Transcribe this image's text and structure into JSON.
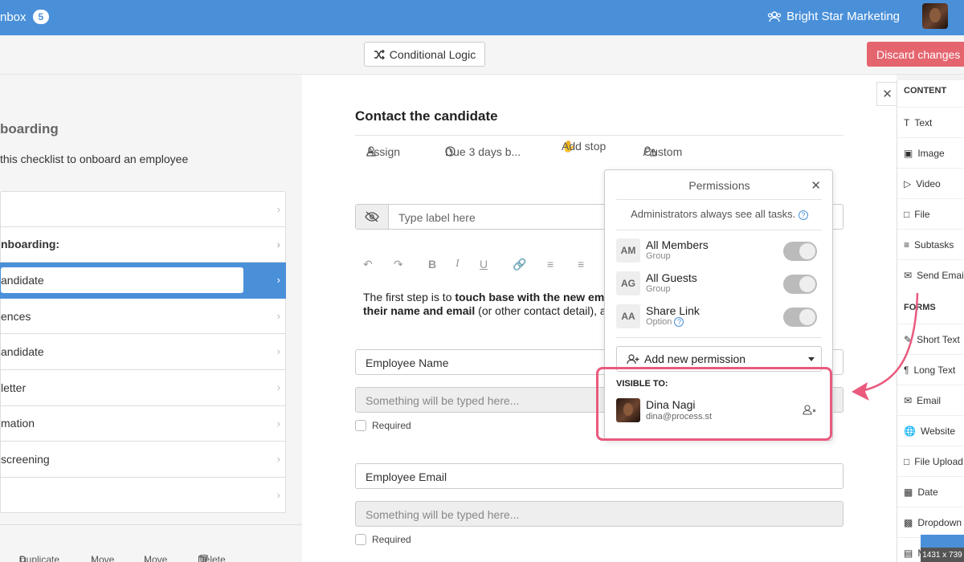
{
  "topbar": {
    "inbox_label": "nbox",
    "inbox_count": "5",
    "company": "Bright Star Marketing"
  },
  "toolbar": {
    "conditional_logic": "Conditional Logic",
    "discard": "Discard changes"
  },
  "left": {
    "title": "boarding",
    "description": "this checklist to onboard an employee",
    "tasks": [
      {
        "label": ""
      },
      {
        "label": "nboarding:"
      },
      {
        "label": "andidate"
      },
      {
        "label": "ences"
      },
      {
        "label": "andidate"
      },
      {
        "label": " letter"
      },
      {
        "label": "mation"
      },
      {
        "label": " screening"
      },
      {
        "label": ""
      }
    ],
    "actions": {
      "duplicate": "Duplicate",
      "move_up": "Move",
      "move_down": "Move",
      "delete": "Delete"
    }
  },
  "main": {
    "task_title": "Contact the candidate",
    "actions": {
      "assign": "Assign",
      "due": "Due 3 days b...",
      "stop": "Add stop",
      "custom": "Custom"
    },
    "label_placeholder": "Type label here",
    "para_a1": "The first step is to ",
    "para_b1": "touch base with the new emp",
    "para_b2": "their name and email",
    "para_a2": " (or other contact detail), a",
    "field1_label": "Employee Name",
    "field1_placeholder": "Something will be typed here...",
    "field2_label": "Employee Email",
    "field2_placeholder": "Something will be typed here...",
    "required": "Required"
  },
  "permissions": {
    "title": "Permissions",
    "note": "Administrators always see all tasks.",
    "rows": [
      {
        "initials": "AM",
        "name": "All Members",
        "sub": "Group"
      },
      {
        "initials": "AG",
        "name": "All Guests",
        "sub": "Group"
      },
      {
        "initials": "AA",
        "name": "Share Link",
        "sub": "Option"
      }
    ],
    "add": "Add new permission",
    "visible_to": "VISIBLE TO:",
    "user": {
      "name": "Dina Nagi",
      "email": "dina@process.st"
    }
  },
  "sidebar": {
    "content_label": "CONTENT",
    "content_items": [
      "Text",
      "Image",
      "Video",
      "File",
      "Subtasks",
      "Send Email"
    ],
    "forms_label": "FORMS",
    "form_items": [
      "Short Text",
      "Long Text",
      "Email",
      "Website",
      "File Upload",
      "Date",
      "Dropdown",
      "M"
    ]
  },
  "overlay": {
    "dims": "1431 x 739"
  },
  "colors": {
    "brand": "#4a90d9",
    "danger": "#e5656f",
    "highlight": "#e95a7e"
  }
}
